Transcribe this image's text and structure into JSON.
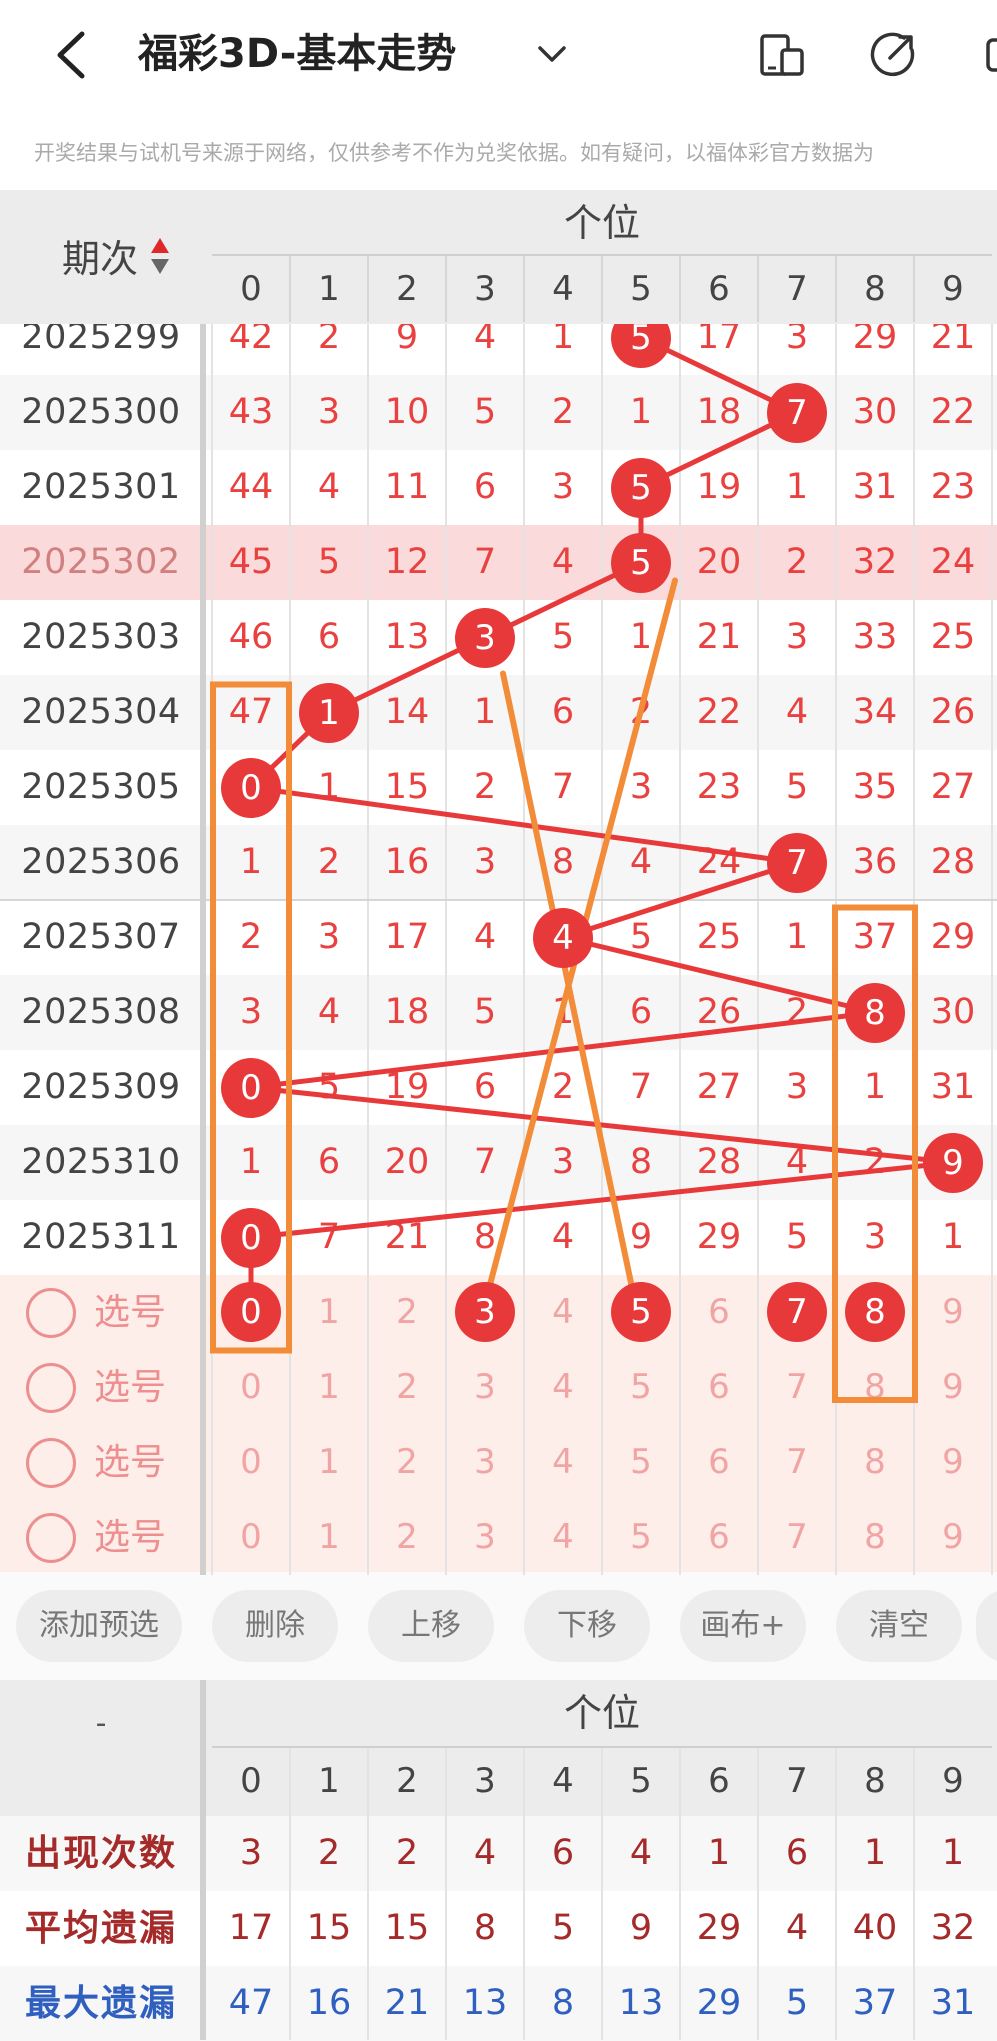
{
  "header": {
    "title": "福彩3D-基本走势",
    "notice": "开奖结果与试机号来源于网络，仅供参考不作为兑奖依据。如有疑问，以福体彩官方数据为"
  },
  "grid": {
    "issue_header": "期次",
    "position_header": "个位",
    "columns": [
      "0",
      "1",
      "2",
      "3",
      "4",
      "5",
      "6",
      "7",
      "8",
      "9"
    ],
    "rows": [
      {
        "issue": "2025299",
        "cells": [
          "42",
          "2",
          "9",
          "4",
          "1",
          "5",
          "17",
          "3",
          "29",
          "21"
        ],
        "hit": 5
      },
      {
        "issue": "2025300",
        "cells": [
          "43",
          "3",
          "10",
          "5",
          "2",
          "1",
          "18",
          "7",
          "30",
          "22"
        ],
        "hit": 7
      },
      {
        "issue": "2025301",
        "cells": [
          "44",
          "4",
          "11",
          "6",
          "3",
          "5",
          "19",
          "1",
          "31",
          "23"
        ],
        "hit": 5
      },
      {
        "issue": "2025302",
        "cells": [
          "45",
          "5",
          "12",
          "7",
          "4",
          "5",
          "20",
          "2",
          "32",
          "24"
        ],
        "hit": 5,
        "highlight": true
      },
      {
        "issue": "2025303",
        "cells": [
          "46",
          "6",
          "13",
          "3",
          "5",
          "1",
          "21",
          "3",
          "33",
          "25"
        ],
        "hit": 3
      },
      {
        "issue": "2025304",
        "cells": [
          "47",
          "1",
          "14",
          "1",
          "6",
          "2",
          "22",
          "4",
          "34",
          "26"
        ],
        "hit": 1
      },
      {
        "issue": "2025305",
        "cells": [
          "0",
          "1",
          "15",
          "2",
          "7",
          "3",
          "23",
          "5",
          "35",
          "27"
        ],
        "hit": 0
      },
      {
        "issue": "2025306",
        "cells": [
          "1",
          "2",
          "16",
          "3",
          "8",
          "4",
          "24",
          "7",
          "36",
          "28"
        ],
        "hit": 7
      },
      {
        "issue": "2025307",
        "cells": [
          "2",
          "3",
          "17",
          "4",
          "4",
          "5",
          "25",
          "1",
          "37",
          "29"
        ],
        "hit": 4
      },
      {
        "issue": "2025308",
        "cells": [
          "3",
          "4",
          "18",
          "5",
          "1",
          "6",
          "26",
          "2",
          "8",
          "30"
        ],
        "hit": 8
      },
      {
        "issue": "2025309",
        "cells": [
          "0",
          "5",
          "19",
          "6",
          "2",
          "7",
          "27",
          "3",
          "1",
          "31"
        ],
        "hit": 0
      },
      {
        "issue": "2025310",
        "cells": [
          "1",
          "6",
          "20",
          "7",
          "3",
          "8",
          "28",
          "4",
          "2",
          "9"
        ],
        "hit": 9
      },
      {
        "issue": "2025311",
        "cells": [
          "0",
          "7",
          "21",
          "8",
          "4",
          "9",
          "29",
          "5",
          "3",
          "1"
        ],
        "hit": 0
      }
    ],
    "selection_rows": [
      {
        "label": "选号",
        "cells": [
          "0",
          "1",
          "2",
          "3",
          "4",
          "5",
          "6",
          "7",
          "8",
          "9"
        ],
        "picked": [
          "0",
          "3",
          "5",
          "7",
          "8"
        ]
      },
      {
        "label": "选号",
        "cells": [
          "0",
          "1",
          "2",
          "3",
          "4",
          "5",
          "6",
          "7",
          "8",
          "9"
        ],
        "picked": []
      },
      {
        "label": "选号",
        "cells": [
          "0",
          "1",
          "2",
          "3",
          "4",
          "5",
          "6",
          "7",
          "8",
          "9"
        ],
        "picked": []
      },
      {
        "label": "选号",
        "cells": [
          "0",
          "1",
          "2",
          "3",
          "4",
          "5",
          "6",
          "7",
          "8",
          "9"
        ],
        "picked": []
      }
    ]
  },
  "toolbar": {
    "buttons": [
      "添加预选",
      "删除",
      "上移",
      "下移",
      "画布+",
      "清空"
    ]
  },
  "stats": {
    "corner": "-",
    "position_header": "个位",
    "columns": [
      "0",
      "1",
      "2",
      "3",
      "4",
      "5",
      "6",
      "7",
      "8",
      "9"
    ],
    "rows": [
      {
        "label": "出现次数",
        "values": [
          "3",
          "2",
          "2",
          "4",
          "6",
          "4",
          "1",
          "6",
          "1",
          "1"
        ],
        "color": "#a52a2a"
      },
      {
        "label": "平均遗漏",
        "values": [
          "17",
          "15",
          "15",
          "8",
          "5",
          "9",
          "29",
          "4",
          "40",
          "32"
        ],
        "color": "#a52a2a"
      },
      {
        "label": "最大遗漏",
        "values": [
          "47",
          "16",
          "21",
          "13",
          "8",
          "13",
          "29",
          "5",
          "37",
          "31"
        ],
        "color": "#2f5fbf"
      }
    ]
  },
  "colors": {
    "accent": "#e8393a",
    "annotation": "#f28c38",
    "highlight_row": "#fadada",
    "selection_bg": "#fdeee9"
  }
}
